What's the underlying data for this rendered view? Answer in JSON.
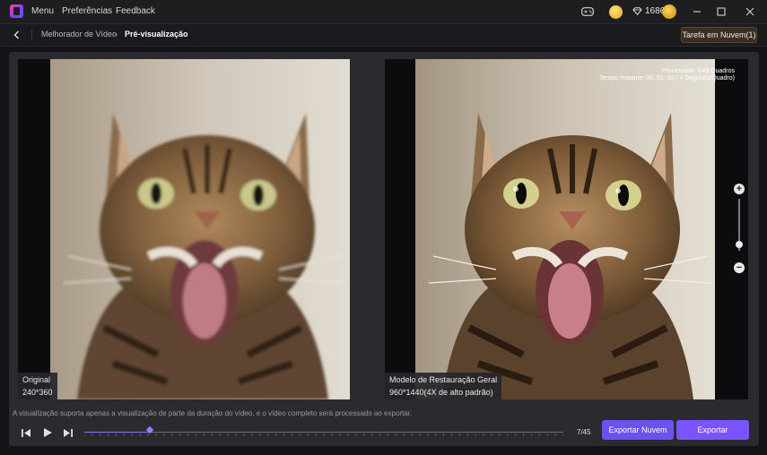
{
  "titlebar": {
    "menu": [
      "Menu",
      "Preferências",
      "Feedback"
    ],
    "gems_count": "1686",
    "icons": [
      "app-logo",
      "gamepad-icon",
      "coin-icon",
      "gem-icon",
      "premium-badge-icon",
      "minimize-icon",
      "maximize-icon",
      "close-icon"
    ]
  },
  "nav": {
    "back_icon": "chevron-left-icon",
    "breadcrumb": [
      "Melhorador de Vídeo",
      "Pré-visualização"
    ],
    "task_button": "Tarefa em Nuvem(1)"
  },
  "preview": {
    "left": {
      "caption_title": "Original",
      "caption_size": "240*360"
    },
    "right": {
      "caption_title": "Modelo de Restauração Geral",
      "caption_size": "960*1440(4X de alto padrão)",
      "processed_text": "Processado 7/45 Quadros",
      "remaining_text": "Tempo restante: 00: 02: 32 ( 4 Segundo/Quadro)"
    },
    "zoom_level": 0.12
  },
  "footer": {
    "notice": "A visualização suporta apenas a visualização de parte da duração do vídeo, e o vídeo completo será processado ao exportar.",
    "frame_counter": "7/45",
    "progress": 0.137,
    "cloud_button": "Exportar Nuvem",
    "export_button": "Exportar"
  },
  "colors": {
    "accent": "#7a55ff",
    "background": "#141416",
    "panel": "#2b2b2f"
  }
}
